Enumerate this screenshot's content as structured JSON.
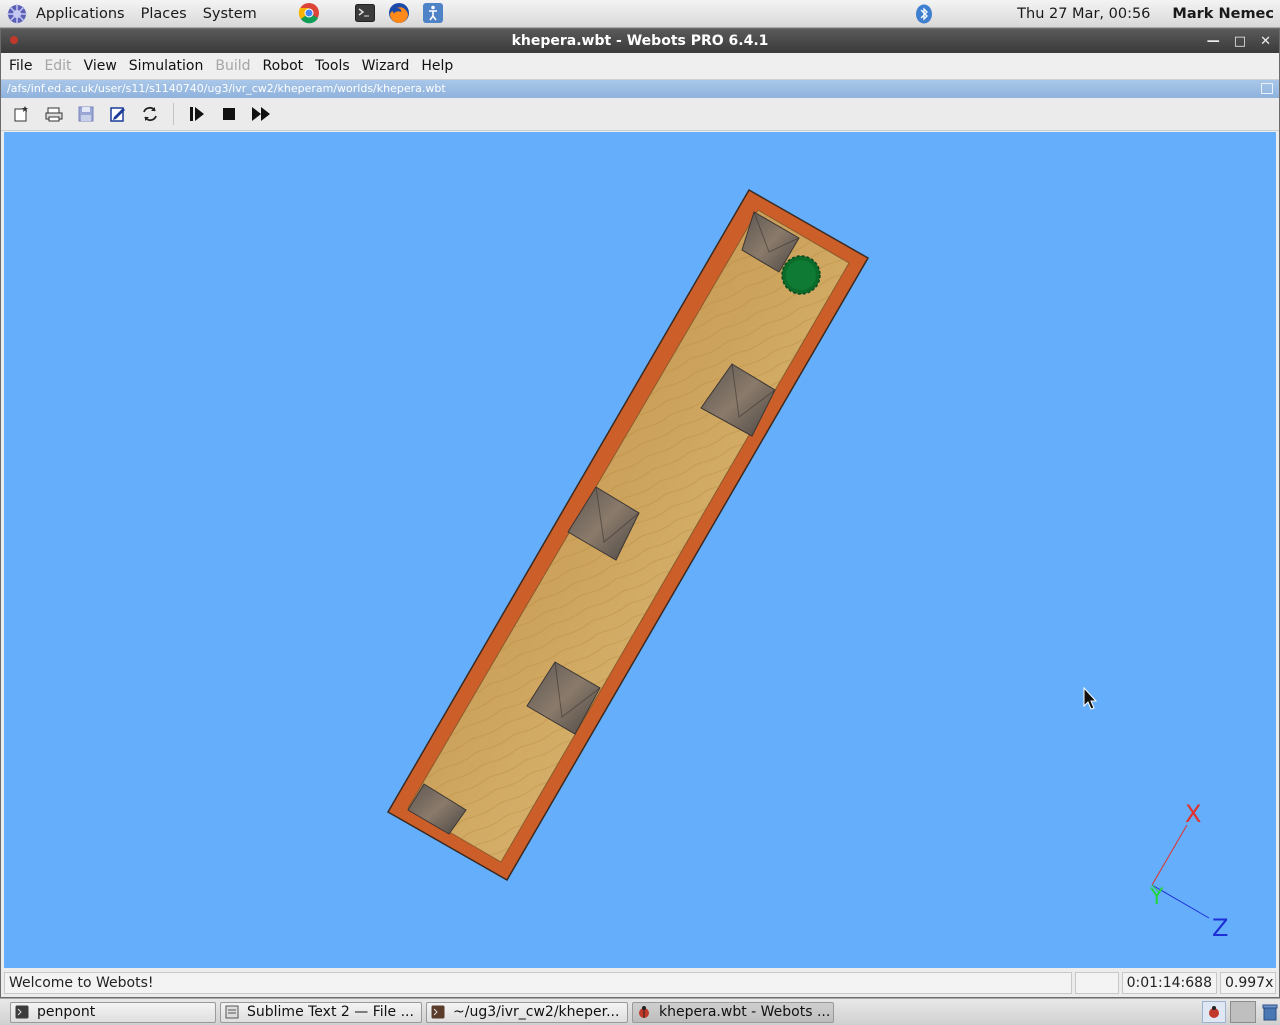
{
  "topbar": {
    "menus": [
      "Applications",
      "Places",
      "System"
    ],
    "clock": "Thu 27 Mar, 00:56",
    "user": "Mark Nemec"
  },
  "window": {
    "title": "khepera.wbt - Webots PRO 6.4.1",
    "menu": [
      "File",
      "Edit",
      "View",
      "Simulation",
      "Build",
      "Robot",
      "Tools",
      "Wizard",
      "Help"
    ],
    "disabled_menu": [
      "Edit",
      "Build"
    ],
    "path": "/afs/inf.ed.ac.uk/user/s11/s1140740/ug3/ivr_cw2/kheperam/worlds/khepera.wbt"
  },
  "scene": {
    "background_color": "#64aefc",
    "wall_color": "#cc5e2a",
    "floor_color": "#c9a15a",
    "robot_color": "#0b6b2a",
    "axis_labels": {
      "x": "X",
      "y": "Y",
      "z": "Z"
    }
  },
  "status": {
    "message": "Welcome to Webots!",
    "time": "0:01:14:688",
    "speed": "0.997x"
  },
  "taskbar": {
    "tasks": [
      "penpont",
      "Sublime Text 2 — File ...",
      "~/ug3/ivr_cw2/kheper...",
      "khepera.wbt - Webots ..."
    ]
  }
}
